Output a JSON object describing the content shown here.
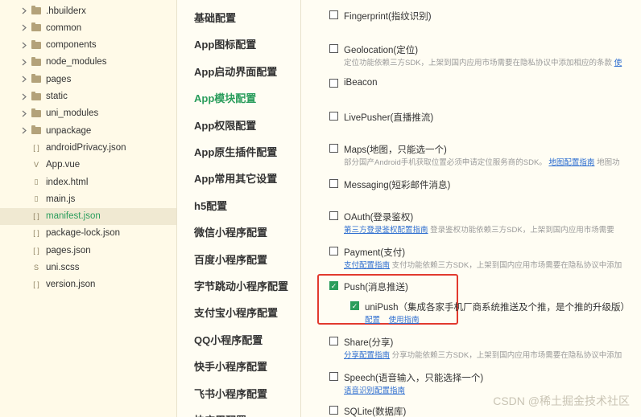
{
  "file_tree": {
    "items": [
      {
        "label": ".hbuilderx",
        "type": "folder",
        "expandable": true
      },
      {
        "label": "common",
        "type": "folder",
        "expandable": true
      },
      {
        "label": "components",
        "type": "folder",
        "expandable": true
      },
      {
        "label": "node_modules",
        "type": "folder",
        "expandable": true
      },
      {
        "label": "pages",
        "type": "folder",
        "expandable": true
      },
      {
        "label": "static",
        "type": "folder",
        "expandable": true
      },
      {
        "label": "uni_modules",
        "type": "folder",
        "expandable": true
      },
      {
        "label": "unpackage",
        "type": "folder",
        "expandable": true
      },
      {
        "label": "androidPrivacy.json",
        "type": "json"
      },
      {
        "label": "App.vue",
        "type": "vue"
      },
      {
        "label": "index.html",
        "type": "html"
      },
      {
        "label": "main.js",
        "type": "js"
      },
      {
        "label": "manifest.json",
        "type": "json",
        "active": true
      },
      {
        "label": "package-lock.json",
        "type": "json"
      },
      {
        "label": "pages.json",
        "type": "json"
      },
      {
        "label": "uni.scss",
        "type": "scss"
      },
      {
        "label": "version.json",
        "type": "json"
      }
    ]
  },
  "settings_nav": {
    "items": [
      {
        "label": "基础配置"
      },
      {
        "label": "App图标配置"
      },
      {
        "label": "App启动界面配置"
      },
      {
        "label": "App模块配置",
        "active": true
      },
      {
        "label": "App权限配置"
      },
      {
        "label": "App原生插件配置"
      },
      {
        "label": "App常用其它设置"
      },
      {
        "label": "h5配置"
      },
      {
        "label": "微信小程序配置"
      },
      {
        "label": "百度小程序配置"
      },
      {
        "label": "字节跳动小程序配置"
      },
      {
        "label": "支付宝小程序配置"
      },
      {
        "label": "QQ小程序配置"
      },
      {
        "label": "快手小程序配置"
      },
      {
        "label": "飞书小程序配置"
      },
      {
        "label": "快应用配置"
      }
    ]
  },
  "modules": {
    "fingerprint": {
      "label": "Fingerprint(指纹识别)",
      "checked": false
    },
    "geolocation": {
      "label": "Geolocation(定位)",
      "checked": false,
      "desc": "定位功能依赖三方SDK，上架到国内应用市场需要在隐私协议中添加相应的条款",
      "desc_link": "使"
    },
    "ibeacon": {
      "label": "iBeacon",
      "checked": false
    },
    "livepusher": {
      "label": "LivePusher(直播推流)",
      "checked": false
    },
    "maps": {
      "label": "Maps(地图，只能选一个)",
      "checked": false,
      "desc": "部分国产Android手机获取位置必须申请定位服务商的SDK。",
      "desc_link": "地图配置指南",
      "desc_tail": "地图功"
    },
    "messaging": {
      "label": "Messaging(短彩邮件消息)",
      "checked": false
    },
    "oauth": {
      "label": "OAuth(登录鉴权)",
      "checked": false,
      "desc_link": "第三方登录鉴权配置指南",
      "desc": "登录鉴权功能依赖三方SDK，上架到国内应用市场需要"
    },
    "payment": {
      "label": "Payment(支付)",
      "checked": false,
      "desc_link": "支付配置指南",
      "desc": "支付功能依赖三方SDK，上架到国内应用市场需要在隐私协议中添加"
    },
    "push": {
      "label": "Push(消息推送)",
      "checked": true
    },
    "unipush": {
      "label": "uniPush（集成各家手机厂商系统推送及个推，是个推的升级版）",
      "checked": true,
      "link1": "配置",
      "link2": "使用指南"
    },
    "share": {
      "label": "Share(分享)",
      "checked": false,
      "desc_link": "分享配置指南",
      "desc": "分享功能依赖三方SDK，上架到国内应用市场需要在隐私协议中添加"
    },
    "speech": {
      "label": "Speech(语音输入，只能选择一个)",
      "checked": false,
      "desc_link": "语音识别配置指南"
    },
    "sqlite": {
      "label": "SQLite(数据库)",
      "checked": false
    }
  },
  "watermark": "CSDN @稀土掘金技术社区"
}
